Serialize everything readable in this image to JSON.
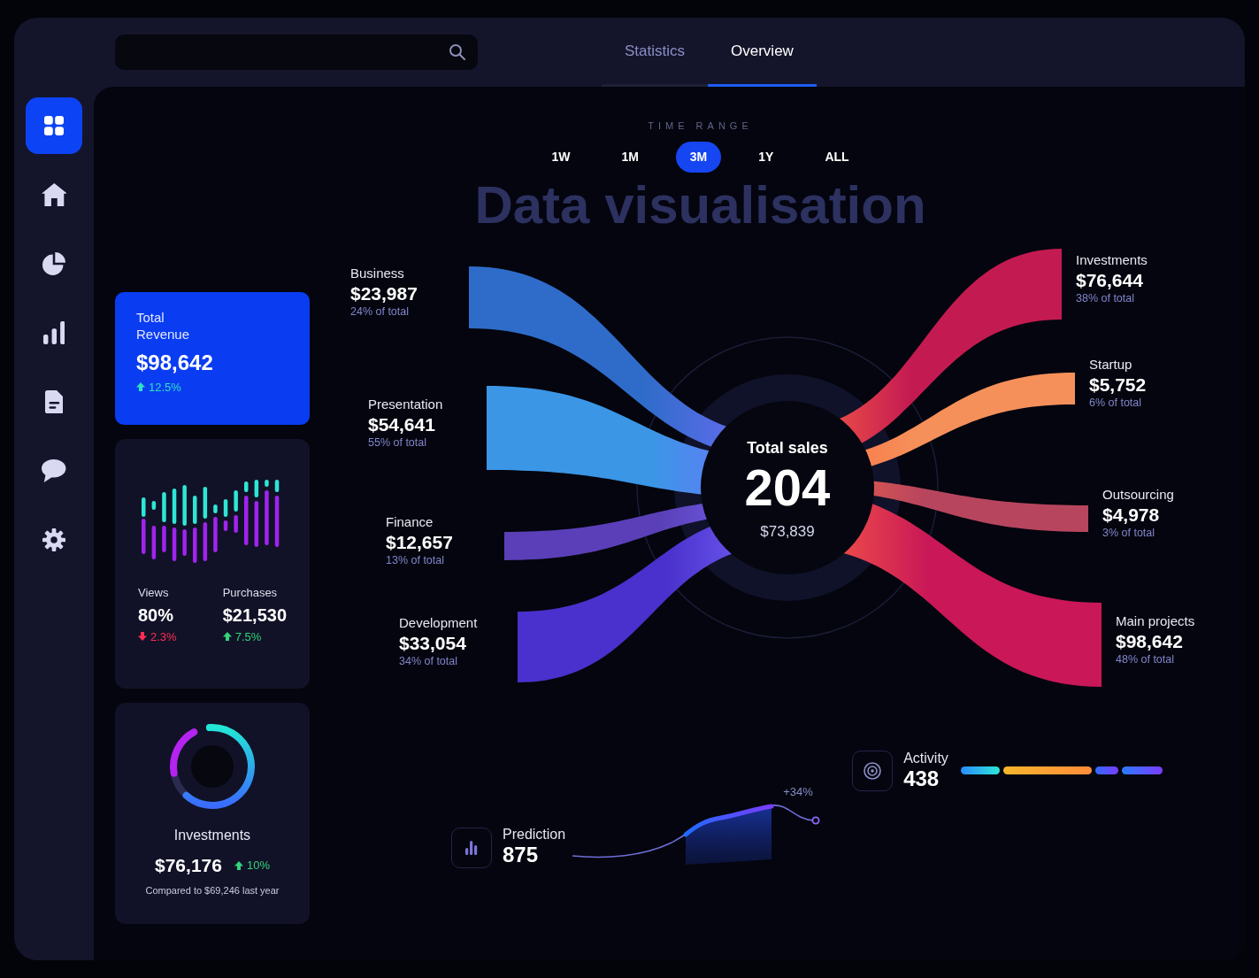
{
  "sidebar": {
    "items": [
      {
        "kind": "grid",
        "selected": true
      },
      {
        "kind": "home",
        "selected": false
      },
      {
        "kind": "pie",
        "selected": false
      },
      {
        "kind": "bars",
        "selected": false
      },
      {
        "kind": "document",
        "selected": false
      },
      {
        "kind": "chat",
        "selected": false
      },
      {
        "kind": "gear",
        "selected": false
      }
    ]
  },
  "tabs": [
    {
      "label": "Statistics",
      "selected": false
    },
    {
      "label": "Overview",
      "selected": true
    }
  ],
  "time_range": {
    "label": "TIME RANGE",
    "options": [
      {
        "label": "1W",
        "selected": false
      },
      {
        "label": "1M",
        "selected": false
      },
      {
        "label": "3M",
        "selected": true
      },
      {
        "label": "1Y",
        "selected": false
      },
      {
        "label": "ALL",
        "selected": false
      }
    ]
  },
  "title": "Data visualisation",
  "revenue_card": {
    "label": "Total Revenue",
    "value": "$98,642",
    "change": "12.5%",
    "rising": true
  },
  "traffic_card": {
    "stats": [
      {
        "label": "Views",
        "value": "80%",
        "change": "2.3%",
        "rising": false
      },
      {
        "label": "Purchases",
        "value": "$21,530",
        "change": "7.5%",
        "rising": true
      }
    ]
  },
  "investments_card": {
    "label": "Investments",
    "value": "$76,176",
    "change": "10%",
    "rising": true,
    "note": "Compared to $69,246 last year"
  },
  "sankey": {
    "center": {
      "label": "Total sales",
      "value": "204",
      "amount": "$73,839"
    },
    "sources": [
      {
        "label": "Business",
        "value": "$23,987",
        "share": "24% of total",
        "color": "#2f6cc9"
      },
      {
        "label": "Presentation",
        "value": "$54,641",
        "share": "55% of total",
        "color": "#3b96e6"
      },
      {
        "label": "Finance",
        "value": "$12,657",
        "share": "13% of total",
        "color": "#5a3fb8"
      },
      {
        "label": "Development",
        "value": "$33,054",
        "share": "34% of total",
        "color": "#4a30cc"
      }
    ],
    "targets": [
      {
        "label": "Investments",
        "value": "$76,644",
        "share": "38% of total",
        "color": "#c41a52"
      },
      {
        "label": "Startup",
        "value": "$5,752",
        "share": "6% of total",
        "color": "#f5905a"
      },
      {
        "label": "Outsourcing",
        "value": "$4,978",
        "share": "3% of total",
        "color": "#b8455e"
      },
      {
        "label": "Main projects",
        "value": "$98,642",
        "share": "48% of total",
        "color": "#c91758"
      }
    ]
  },
  "prediction": {
    "label": "Prediction",
    "value": "875",
    "change": "+34%"
  },
  "activity": {
    "label": "Activity",
    "value": "438"
  }
}
